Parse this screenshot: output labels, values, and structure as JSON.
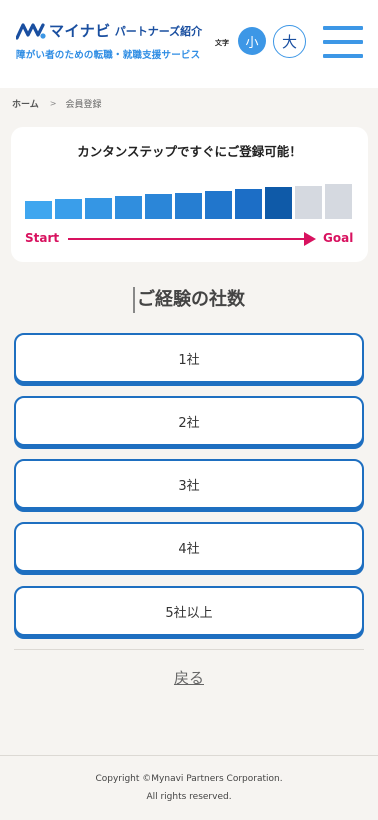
{
  "header": {
    "logo_text": "マイナビ",
    "logo_sub": "パートナーズ紹介",
    "tagline": "障がい者のための転職・就職支援サービス",
    "font_size_label": "文字",
    "font_small_label": "小",
    "font_large_label": "大"
  },
  "breadcrumb": {
    "home": "ホーム",
    "separator": ">",
    "current": "会員登録"
  },
  "progress": {
    "title": "カンタンステップですぐにご登録可能！",
    "start_label": "Start",
    "goal_label": "Goal",
    "total_steps": 11,
    "completed_steps": 9,
    "step_colors": [
      "#3fa6ef",
      "#3a9eea",
      "#3596e4",
      "#308ede",
      "#2b86d8",
      "#267ed2",
      "#2176cc",
      "#1c6ec6",
      "#0f5aa8",
      "#d5d9e0",
      "#d5d9e0"
    ],
    "accent_color": "#d8125f"
  },
  "question": {
    "title": "ご経験の社数"
  },
  "options": [
    {
      "label": "1社"
    },
    {
      "label": "2社"
    },
    {
      "label": "3社"
    },
    {
      "label": "4社"
    },
    {
      "label": "5社以上"
    }
  ],
  "back_label": "戻る",
  "footer": {
    "copyright": "Copyright ©Mynavi Partners Corporation.",
    "rights": "All rights reserved."
  },
  "colors": {
    "brand": "#1a4fa0",
    "accent": "#3d97e6",
    "option_border": "#1e6fc0"
  }
}
